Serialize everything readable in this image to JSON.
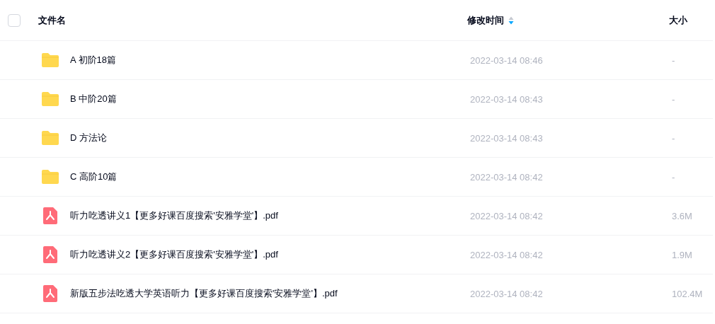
{
  "table": {
    "select_all": {
      "checked": false
    },
    "columns": [
      {
        "label": "文件名"
      },
      {
        "label": "修改时间",
        "sorted": true,
        "descending": true
      },
      {
        "label": "大小"
      }
    ],
    "rows": [
      {
        "kind": "folder",
        "name": "A 初阶18篇",
        "modified": "2022-03-14 08:46",
        "size": "-"
      },
      {
        "kind": "folder",
        "name": "B 中阶20篇",
        "modified": "2022-03-14 08:43",
        "size": "-"
      },
      {
        "kind": "folder",
        "name": "D 方法论",
        "modified": "2022-03-14 08:43",
        "size": "-"
      },
      {
        "kind": "folder",
        "name": "C 高阶10篇",
        "modified": "2022-03-14 08:42",
        "size": "-"
      },
      {
        "kind": "pdf",
        "name": "听力吃透讲义1【更多好课百度搜索'安雅学堂'】.pdf",
        "modified": "2022-03-14 08:42",
        "size": "3.6M"
      },
      {
        "kind": "pdf",
        "name": "听力吃透讲义2【更多好课百度搜索'安雅学堂'】.pdf",
        "modified": "2022-03-14 08:42",
        "size": "1.9M"
      },
      {
        "kind": "pdf",
        "name": "新版五步法吃透大学英语听力【更多好课百度搜索'安雅学堂'】.pdf",
        "modified": "2022-03-14 08:42",
        "size": "102.4M"
      }
    ]
  }
}
